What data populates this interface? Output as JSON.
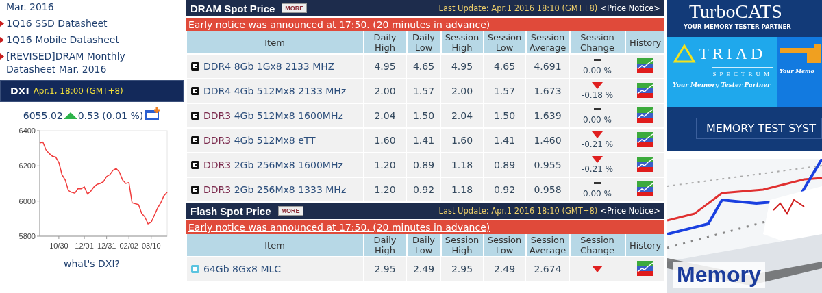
{
  "sidebar": {
    "links": [
      {
        "text": "Mar. 2016",
        "bullet": false
      },
      {
        "text": "1Q16 SSD Datasheet",
        "bullet": true
      },
      {
        "text": "1Q16 Mobile Datasheet",
        "bullet": true
      },
      {
        "text": "[REVISED]DRAM Monthly Datasheet Mar. 2016",
        "bullet": true
      }
    ]
  },
  "dxi": {
    "title": "DXI",
    "time": "Apr.1, 18:00 (GMT+8)",
    "value": "6055.02",
    "change": {
      "kind": "up",
      "text": "0.53 (0.01 %)"
    },
    "chart_data": {
      "type": "line",
      "categories": [
        null,
        null,
        null,
        null,
        null,
        null,
        "10/30",
        null,
        null,
        null,
        null,
        null,
        null,
        null,
        "12/01",
        null,
        null,
        null,
        null,
        null,
        null,
        "12/31",
        null,
        null,
        null,
        null,
        null,
        null,
        "02/02",
        null,
        null,
        null,
        null,
        null,
        null,
        "03/10",
        null,
        null,
        null,
        null,
        null
      ],
      "series": [
        {
          "color": "#f03c3c",
          "values": [
            6330,
            6335,
            6290,
            6270,
            6255,
            6250,
            6220,
            6150,
            6120,
            6060,
            6050,
            6045,
            6070,
            6070,
            6080,
            6040,
            6055,
            6080,
            6095,
            6100,
            6110,
            6140,
            6150,
            6175,
            6185,
            6165,
            6120,
            6100,
            6105,
            5990,
            5985,
            5980,
            5930,
            5910,
            5870,
            5880,
            5920,
            5960,
            5990,
            6030,
            6050
          ]
        }
      ],
      "ylim": [
        5800,
        6400
      ],
      "yticks": [
        5800,
        6000,
        6200,
        6400
      ]
    },
    "link": "what's DXI?"
  },
  "price_tables": [
    {
      "title": "DRAM Spot Price",
      "more": "MORE",
      "last_update": "Last Update: Apr.1 2016 18:10 (GMT+8)",
      "price_notice": "<Price Notice>",
      "notice": "Early notice was announced at 17:50. (20 minutes in advance)",
      "columns": [
        "Item",
        "Daily High",
        "Daily Low",
        "Session High",
        "Session Low",
        "Session Average",
        "Session Change",
        "History"
      ],
      "rows": [
        {
          "kind": "dram",
          "type": "DDR4",
          "color": "#2d4f7c",
          "spec": "8Gb 1Gx8 2133 MHZ",
          "values": [
            "4.95",
            "4.65",
            "4.95",
            "4.65",
            "4.691"
          ],
          "change": {
            "kind": "flat",
            "text": "0.00 %"
          }
        },
        {
          "kind": "dram",
          "type": "DDR4",
          "color": "#2d4f7c",
          "spec": "4Gb 512Mx8 2133 MHz",
          "values": [
            "2.00",
            "1.57",
            "2.00",
            "1.57",
            "1.673"
          ],
          "change": {
            "kind": "down",
            "text": "-0.18 %"
          }
        },
        {
          "kind": "dram",
          "type": "DDR3",
          "color": "#7b2a4d",
          "spec": "4Gb 512Mx8 1600MHz",
          "values": [
            "2.04",
            "1.50",
            "2.04",
            "1.50",
            "1.639"
          ],
          "change": {
            "kind": "flat",
            "text": "0.00 %"
          }
        },
        {
          "kind": "dram",
          "type": "DDR3",
          "color": "#7b2a4d",
          "spec": "4Gb 512Mx8 eTT",
          "values": [
            "1.60",
            "1.41",
            "1.60",
            "1.41",
            "1.460"
          ],
          "change": {
            "kind": "down",
            "text": "-0.21 %"
          }
        },
        {
          "kind": "dram",
          "type": "DDR3",
          "color": "#7b2a4d",
          "spec": "2Gb 256Mx8 1600MHz",
          "values": [
            "1.20",
            "0.89",
            "1.18",
            "0.89",
            "0.955"
          ],
          "change": {
            "kind": "down",
            "text": "-0.21 %"
          }
        },
        {
          "kind": "dram",
          "type": "DDR3",
          "color": "#7b2a4d",
          "spec": "2Gb 256Mx8 1333 MHz",
          "values": [
            "1.20",
            "0.92",
            "1.18",
            "0.92",
            "0.958"
          ],
          "change": {
            "kind": "flat",
            "text": "0.00 %"
          }
        }
      ]
    },
    {
      "title": "Flash Spot Price",
      "more": "MORE",
      "last_update": "Last Update: Apr.1 2016 18:10 (GMT+8)",
      "price_notice": "<Price Notice>",
      "notice": "Early notice was announced at 17:50. (20 minutes in advance)",
      "columns": [
        "Item",
        "Daily High",
        "Daily Low",
        "Session High",
        "Session Low",
        "Session Average",
        "Session Change",
        "History"
      ],
      "rows": [
        {
          "kind": "flash",
          "spec": "64Gb 8Gx8 MLC",
          "values": [
            "2.95",
            "2.49",
            "2.95",
            "2.49",
            "2.674"
          ],
          "change": {
            "kind": "down"
          }
        }
      ]
    }
  ],
  "ads": {
    "banner": {
      "title": "TurboCATS",
      "tagline": "YOUR MEMORY TESTER PARTNER",
      "brand": "TRIAD",
      "brand_sub": "SPECTRUM",
      "slogan": "Your Memory Tester Partner",
      "slogan_cut": "Your Memo",
      "footer": "MEMORY TEST SYST"
    },
    "photo_ad": {
      "kind": "picture",
      "caption": "Memory"
    }
  }
}
